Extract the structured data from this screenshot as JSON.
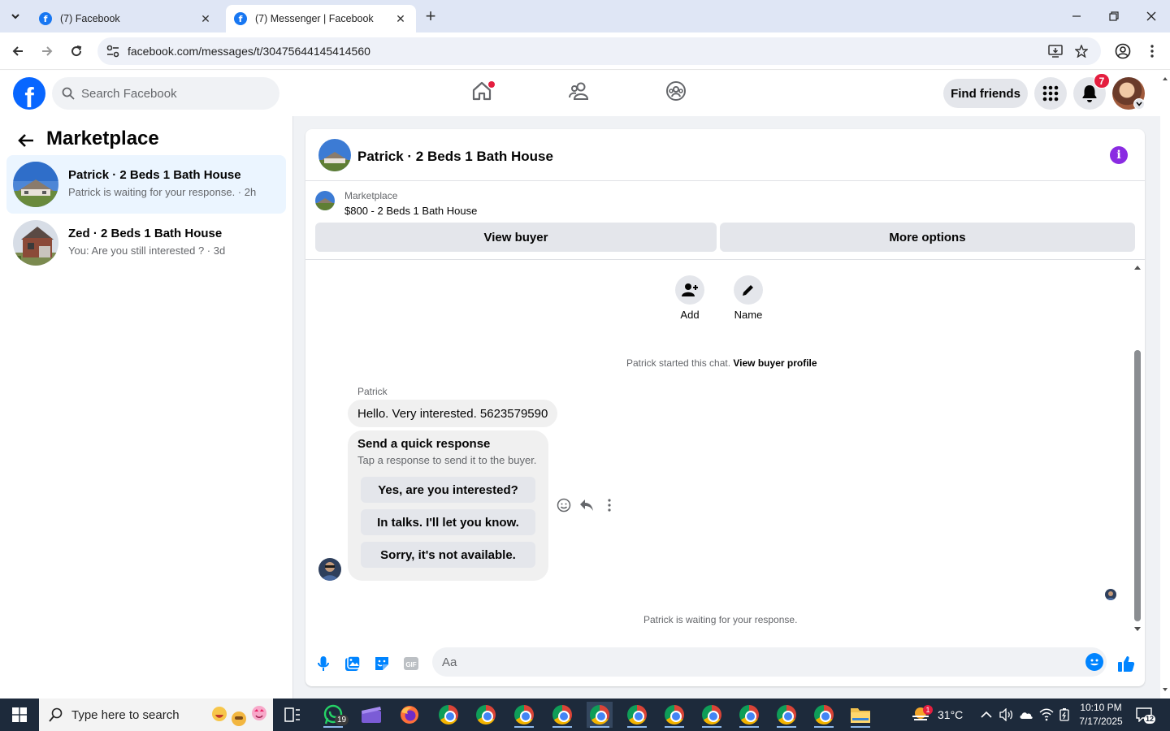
{
  "browser": {
    "tabs": [
      {
        "title": "(7) Facebook"
      },
      {
        "title": "(7) Messenger | Facebook"
      }
    ],
    "url": "facebook.com/messages/t/30475644145414560"
  },
  "fb": {
    "search_placeholder": "Search Facebook",
    "find_friends": "Find friends",
    "notif_count": "7"
  },
  "sidebar": {
    "title": "Marketplace",
    "conversations": [
      {
        "name": "Patrick · 2 Beds 1 Bath House",
        "sub": "Patrick is waiting for your response. · 2h"
      },
      {
        "name": "Zed · 2 Beds 1 Bath House",
        "sub": "You: Are you still interested ? · 3d"
      }
    ]
  },
  "chat": {
    "title": "Patrick · 2 Beds 1 Bath House",
    "marketplace_label": "Marketplace",
    "listing": "$800 - 2 Beds 1 Bath House",
    "view_buyer": "View buyer",
    "more_options": "More options",
    "add_label": "Add",
    "name_label": "Name",
    "started_text": "Patrick started this chat. ",
    "view_profile": "View buyer profile",
    "sender": "Patrick",
    "message": "Hello. Very interested. 5623579590",
    "quick_title": "Send a quick response",
    "quick_sub": "Tap a response to send it to the buyer.",
    "quick_responses": [
      "Yes, are you interested?",
      "In talks. I'll let you know.",
      "Sorry, it's not available."
    ],
    "waiting": "Patrick is waiting for your response.",
    "input_placeholder": "Aa"
  },
  "taskbar": {
    "search_placeholder": "Type here to search",
    "whatsapp_badge": "19",
    "weather_badge": "1",
    "temperature": "31°C",
    "time": "10:10 PM",
    "date": "7/17/2025",
    "notif_count": "12"
  },
  "colors": {
    "fb_blue": "#0866ff",
    "messenger_blue": "#0084ff",
    "active_conv": "#ebf5ff",
    "taskbar": "#1d2a3b"
  }
}
